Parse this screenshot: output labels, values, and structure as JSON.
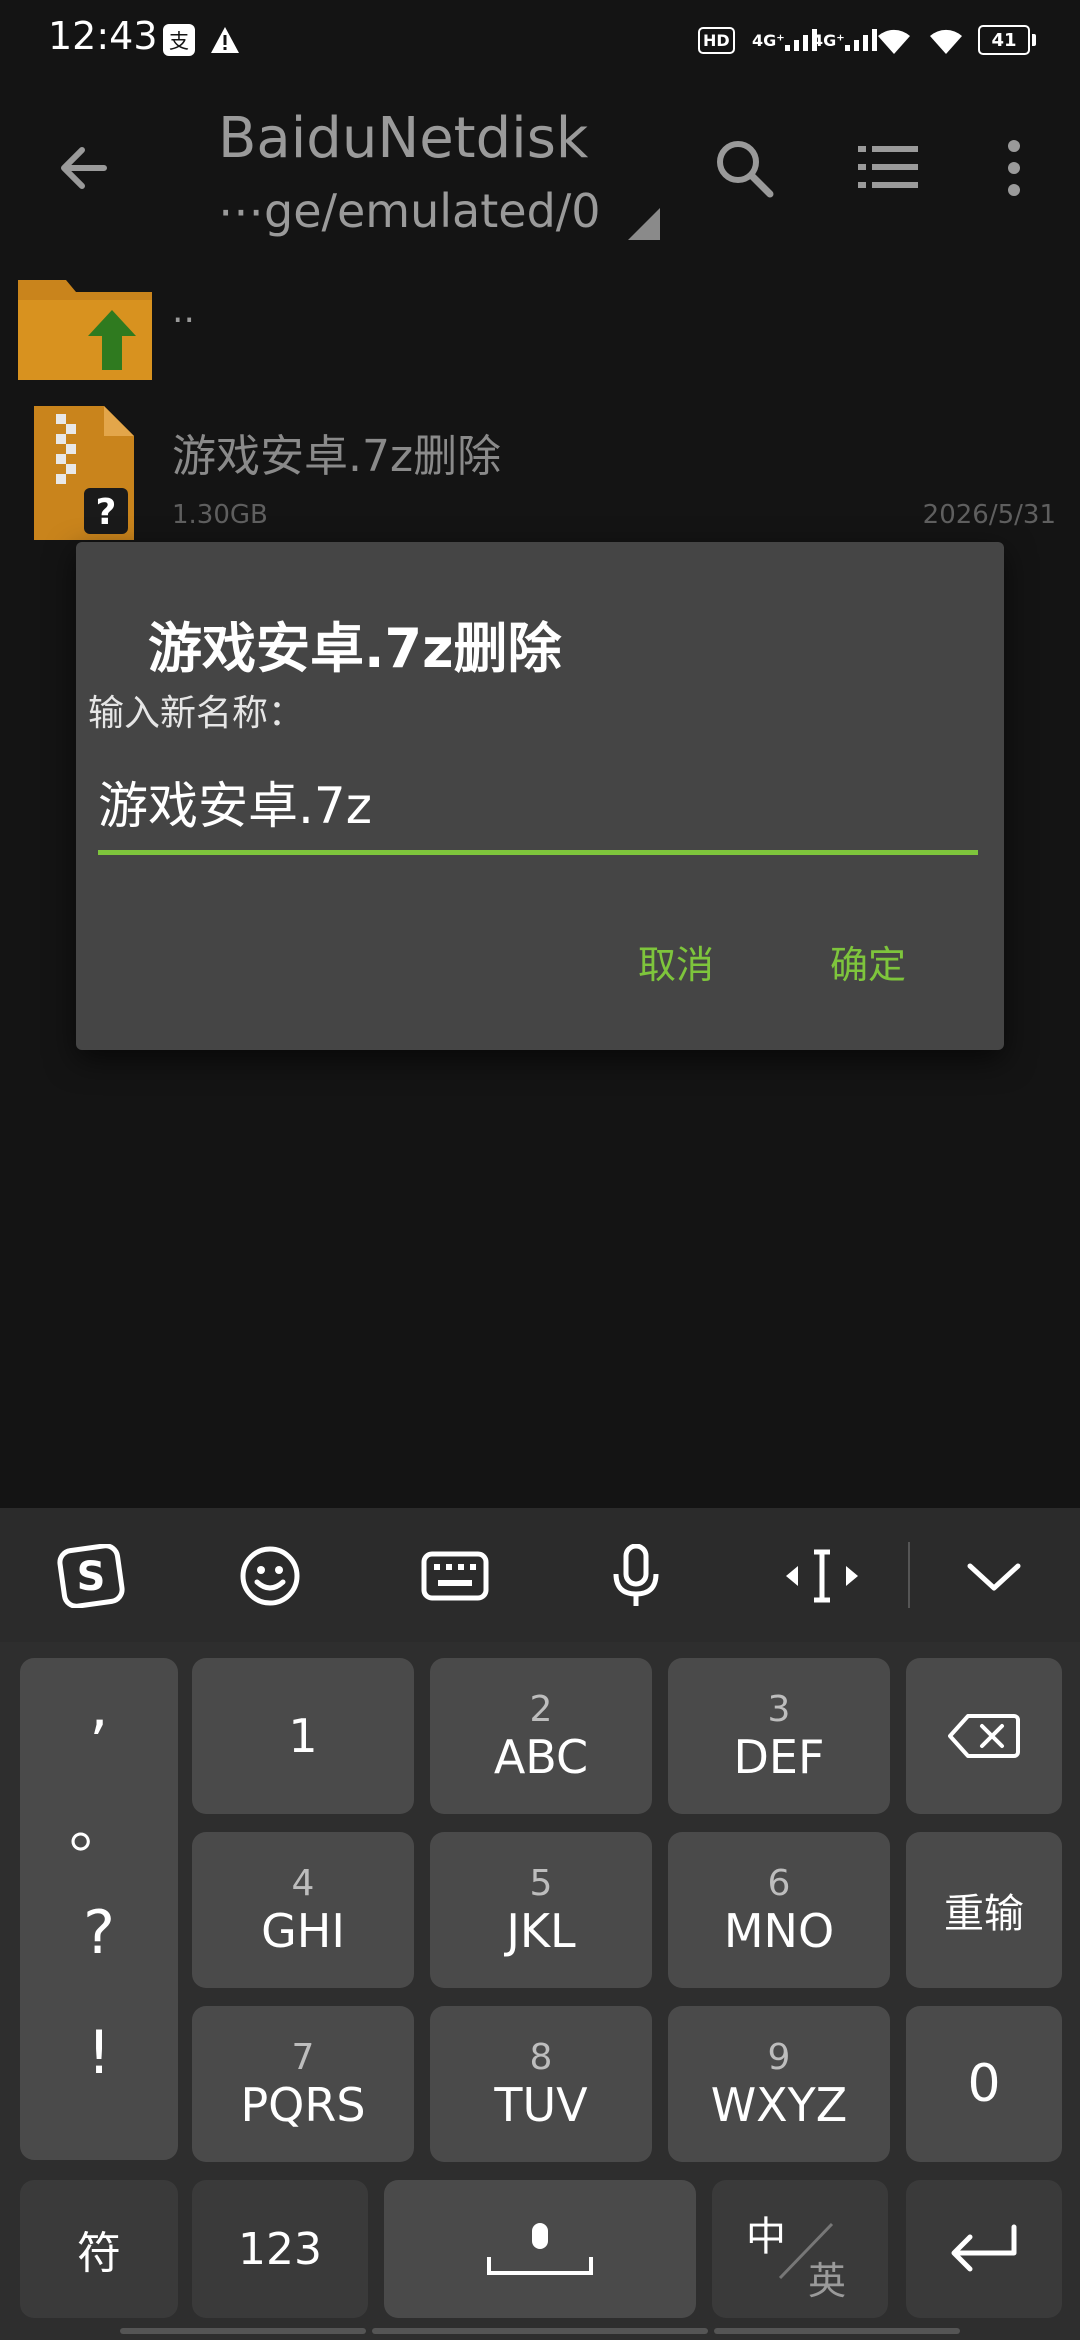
{
  "status": {
    "time": "12:43",
    "hd_label": "HD",
    "signal1_label": "4G⁺",
    "signal2_label": "4G⁺",
    "battery": "41"
  },
  "appbar": {
    "title": "BaiduNetdisk",
    "path": "⋯ge/emulated/0"
  },
  "files": {
    "parent_label": "..",
    "item": {
      "name": "游戏安卓.7z删除",
      "size": "1.30GB",
      "date": "2026/5/31"
    }
  },
  "dialog": {
    "title": "游戏安卓.7z删除",
    "label": "输入新名称：",
    "input_value": "游戏安卓.7z",
    "cancel": "取消",
    "confirm": "确定"
  },
  "keyboard": {
    "punct": [
      ",",
      "。",
      "?",
      "!"
    ],
    "keys": [
      {
        "num": "",
        "letters": "1"
      },
      {
        "num": "2",
        "letters": "ABC"
      },
      {
        "num": "3",
        "letters": "DEF"
      },
      {
        "num": "4",
        "letters": "GHI"
      },
      {
        "num": "5",
        "letters": "JKL"
      },
      {
        "num": "6",
        "letters": "MNO"
      },
      {
        "num": "7",
        "letters": "PQRS"
      },
      {
        "num": "8",
        "letters": "TUV"
      },
      {
        "num": "9",
        "letters": "WXYZ"
      }
    ],
    "retype": "重输",
    "zero": "0",
    "symbols": "符",
    "numbers": "123",
    "lang_zh": "中",
    "lang_en": "英"
  },
  "colors": {
    "accent": "#7ec53c",
    "background": "#141414",
    "dialog": "#454545"
  }
}
